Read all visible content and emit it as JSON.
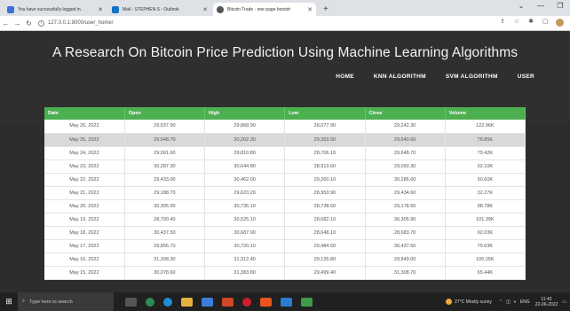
{
  "browser": {
    "tabs": [
      {
        "title": "You have successfully logged in.",
        "favicon_color": "#3b6fd8"
      },
      {
        "title": "Mail - STEPHEN.S - Outlook",
        "favicon_color": "#1570c9"
      },
      {
        "title": "Bitcoin Trade - one page bootstr",
        "favicon_color": "#555555"
      }
    ],
    "new_tab": "+",
    "url": "127.0.0.1:8000/user_home/"
  },
  "page": {
    "title": "A Research On Bitcoin Price Prediction Using Machine Learning Algorithms",
    "nav": [
      "HOME",
      "KNN ALGORITHM",
      "SVM ALGORITHM",
      "USER"
    ]
  },
  "table": {
    "columns": [
      "Date",
      "Open",
      "High",
      "Low",
      "Close",
      "Volume"
    ],
    "rows": [
      [
        "May 26, 2022",
        "29,537.90",
        "29,868.90",
        "28,077.90",
        "29,242.30",
        "122.96K"
      ],
      [
        "May 25, 2022",
        "29,648.70",
        "30,202.30",
        "29,353.50",
        "29,540.60",
        "78.85K"
      ],
      [
        "May 24, 2022",
        "29,091.60",
        "29,810.80",
        "28,706.10",
        "29,648.70",
        "79.42K"
      ],
      [
        "May 23, 2022",
        "30,287.30",
        "30,644.80",
        "28,913.60",
        "29,093.30",
        "92.10K"
      ],
      [
        "May 22, 2022",
        "29,433.00",
        "30,462.00",
        "29,260.10",
        "30,286.60",
        "50.60K"
      ],
      [
        "May 21, 2022",
        "29,188.70",
        "29,623.20",
        "28,953.90",
        "29,434.60",
        "32.27K"
      ],
      [
        "May 20, 2022",
        "30,305.90",
        "30,735.10",
        "28,738.50",
        "29,178.60",
        "98.78K"
      ],
      [
        "May 19, 2022",
        "28,700.40",
        "30,525.10",
        "28,682.10",
        "30,305.90",
        "101.39K"
      ],
      [
        "May 18, 2022",
        "30,437.50",
        "30,687.90",
        "28,648.10",
        "28,683.70",
        "92.03K"
      ],
      [
        "May 17, 2022",
        "29,856.70",
        "30,720.10",
        "29,484.50",
        "30,437.50",
        "79.63K"
      ],
      [
        "May 16, 2022",
        "31,308.30",
        "31,312.40",
        "29,135.80",
        "29,849.00",
        "100.25K"
      ],
      [
        "May 15, 2022",
        "30,078.60",
        "31,383.80",
        "29,499.40",
        "31,308.70",
        "65.44K"
      ]
    ]
  },
  "taskbar": {
    "search_placeholder": "Type here to search",
    "weather": "27°C  Mostly sunny",
    "language": "ENG",
    "time": "11:42",
    "date": "22-06-2022"
  }
}
